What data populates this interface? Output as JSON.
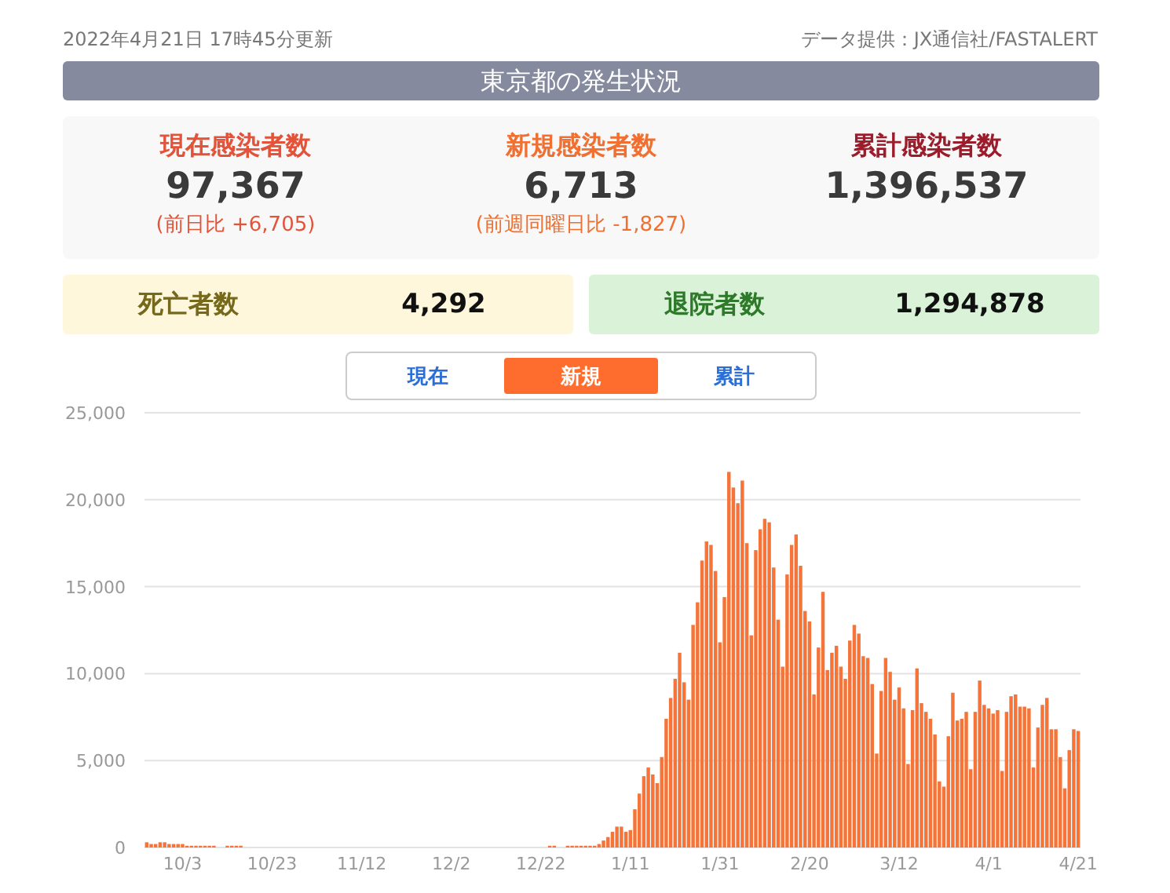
{
  "header": {
    "updated": "2022年4月21日 17時45分更新",
    "source": "データ提供：JX通信社/FASTALERT"
  },
  "title": "東京都の発生状況",
  "stats": [
    {
      "label": "現在感染者数",
      "value": "97,367",
      "change": "(前日比 +6,705)",
      "color": "#e2533a"
    },
    {
      "label": "新規感染者数",
      "value": "6,713",
      "change": "(前週同曜日比 -1,827)",
      "color": "#f07032"
    },
    {
      "label": "累計感染者数",
      "value": "1,396,537",
      "color": "#9b1d2b"
    }
  ],
  "totals": [
    {
      "label": "死亡者数",
      "value": "4,292",
      "kind": "deaths"
    },
    {
      "label": "退院者数",
      "value": "1,294,878",
      "kind": "recovered"
    }
  ],
  "tabs": [
    {
      "label": "現在",
      "selected": false
    },
    {
      "label": "新規",
      "selected": true
    },
    {
      "label": "累計",
      "selected": false
    }
  ],
  "chart": {
    "chart_data": {
      "type": "bar",
      "grid": true,
      "categories": [
        null,
        null,
        null,
        null,
        null,
        null,
        null,
        null,
        "10/3",
        null,
        null,
        null,
        null,
        null,
        null,
        null,
        null,
        null,
        null,
        null,
        null,
        null,
        null,
        null,
        null,
        null,
        null,
        null,
        "10/23",
        null,
        null,
        null,
        null,
        null,
        null,
        null,
        null,
        null,
        null,
        null,
        null,
        null,
        null,
        null,
        null,
        null,
        null,
        null,
        "11/12",
        null,
        null,
        null,
        null,
        null,
        null,
        null,
        null,
        null,
        null,
        null,
        null,
        null,
        null,
        null,
        null,
        null,
        null,
        null,
        "12/2",
        null,
        null,
        null,
        null,
        null,
        null,
        null,
        null,
        null,
        null,
        null,
        null,
        null,
        null,
        null,
        null,
        null,
        null,
        null,
        "12/22",
        null,
        null,
        null,
        null,
        null,
        null,
        null,
        null,
        null,
        null,
        null,
        null,
        null,
        null,
        null,
        null,
        null,
        null,
        null,
        "1/11",
        null,
        null,
        null,
        null,
        null,
        null,
        null,
        null,
        null,
        null,
        null,
        null,
        null,
        null,
        null,
        null,
        null,
        null,
        null,
        "1/31",
        null,
        null,
        null,
        null,
        null,
        null,
        null,
        null,
        null,
        null,
        null,
        null,
        null,
        null,
        null,
        null,
        null,
        null,
        null,
        "2/20",
        null,
        null,
        null,
        null,
        null,
        null,
        null,
        null,
        null,
        null,
        null,
        null,
        null,
        null,
        null,
        null,
        null,
        null,
        null,
        "3/12",
        null,
        null,
        null,
        null,
        null,
        null,
        null,
        null,
        null,
        null,
        null,
        null,
        null,
        null,
        null,
        null,
        null,
        null,
        null,
        "4/1",
        null,
        null,
        null,
        null,
        null,
        null,
        null,
        null,
        null,
        null,
        null,
        null,
        null,
        null,
        null,
        null,
        null,
        null,
        null,
        "4/21"
      ],
      "series": [
        {
          "color": "#f4743a",
          "values": [
            300,
            200,
            200,
            300,
            300,
            200,
            200,
            200,
            200,
            100,
            100,
            100,
            100,
            100,
            100,
            100,
            0,
            0,
            100,
            100,
            100,
            100,
            0,
            0,
            0,
            0,
            0,
            0,
            0,
            0,
            0,
            0,
            0,
            0,
            0,
            0,
            0,
            0,
            0,
            0,
            0,
            0,
            0,
            0,
            0,
            0,
            0,
            0,
            0,
            0,
            0,
            0,
            0,
            0,
            0,
            0,
            0,
            0,
            0,
            0,
            0,
            0,
            0,
            0,
            0,
            0,
            0,
            0,
            0,
            0,
            0,
            0,
            0,
            0,
            0,
            0,
            0,
            0,
            0,
            0,
            0,
            0,
            0,
            0,
            0,
            0,
            0,
            0,
            0,
            0,
            100,
            100,
            0,
            0,
            100,
            100,
            100,
            100,
            100,
            100,
            100,
            200,
            400,
            600,
            900,
            1200,
            1200,
            900,
            1000,
            2200,
            3100,
            4100,
            4600,
            4200,
            3700,
            5200,
            7400,
            8600,
            9700,
            11200,
            9500,
            8500,
            12800,
            14100,
            16500,
            17600,
            17400,
            15900,
            11800,
            14400,
            21600,
            20700,
            19800,
            21100,
            17500,
            12200,
            17100,
            18300,
            18900,
            18700,
            16100,
            13100,
            10400,
            15700,
            17400,
            18000,
            16200,
            13600,
            13000,
            8800,
            11500,
            14700,
            10200,
            11200,
            11600,
            10400,
            9700,
            11900,
            12800,
            12300,
            11000,
            10900,
            9400,
            5400,
            9000,
            10900,
            10100,
            8500,
            9200,
            8000,
            4800,
            7900,
            10300,
            8300,
            7800,
            7400,
            6500,
            3800,
            3500,
            6400,
            8900,
            7300,
            7400,
            7800,
            4500,
            7800,
            9600,
            8200,
            8000,
            7700,
            7900,
            4400,
            7800,
            8700,
            8800,
            8100,
            8100,
            8000,
            4600,
            6900,
            8200,
            8600,
            6800,
            6800,
            5200,
            3400,
            5600,
            6800,
            6700
          ]
        }
      ],
      "ylim": [
        0,
        25000
      ],
      "yticks": [
        {
          "value": 0,
          "label": "0"
        },
        {
          "value": 5000,
          "label": "5,000"
        },
        {
          "value": 10000,
          "label": "10,000"
        },
        {
          "value": 15000,
          "label": "15,000"
        },
        {
          "value": 20000,
          "label": "20,000"
        },
        {
          "value": 25000,
          "label": "25,000"
        }
      ]
    }
  }
}
